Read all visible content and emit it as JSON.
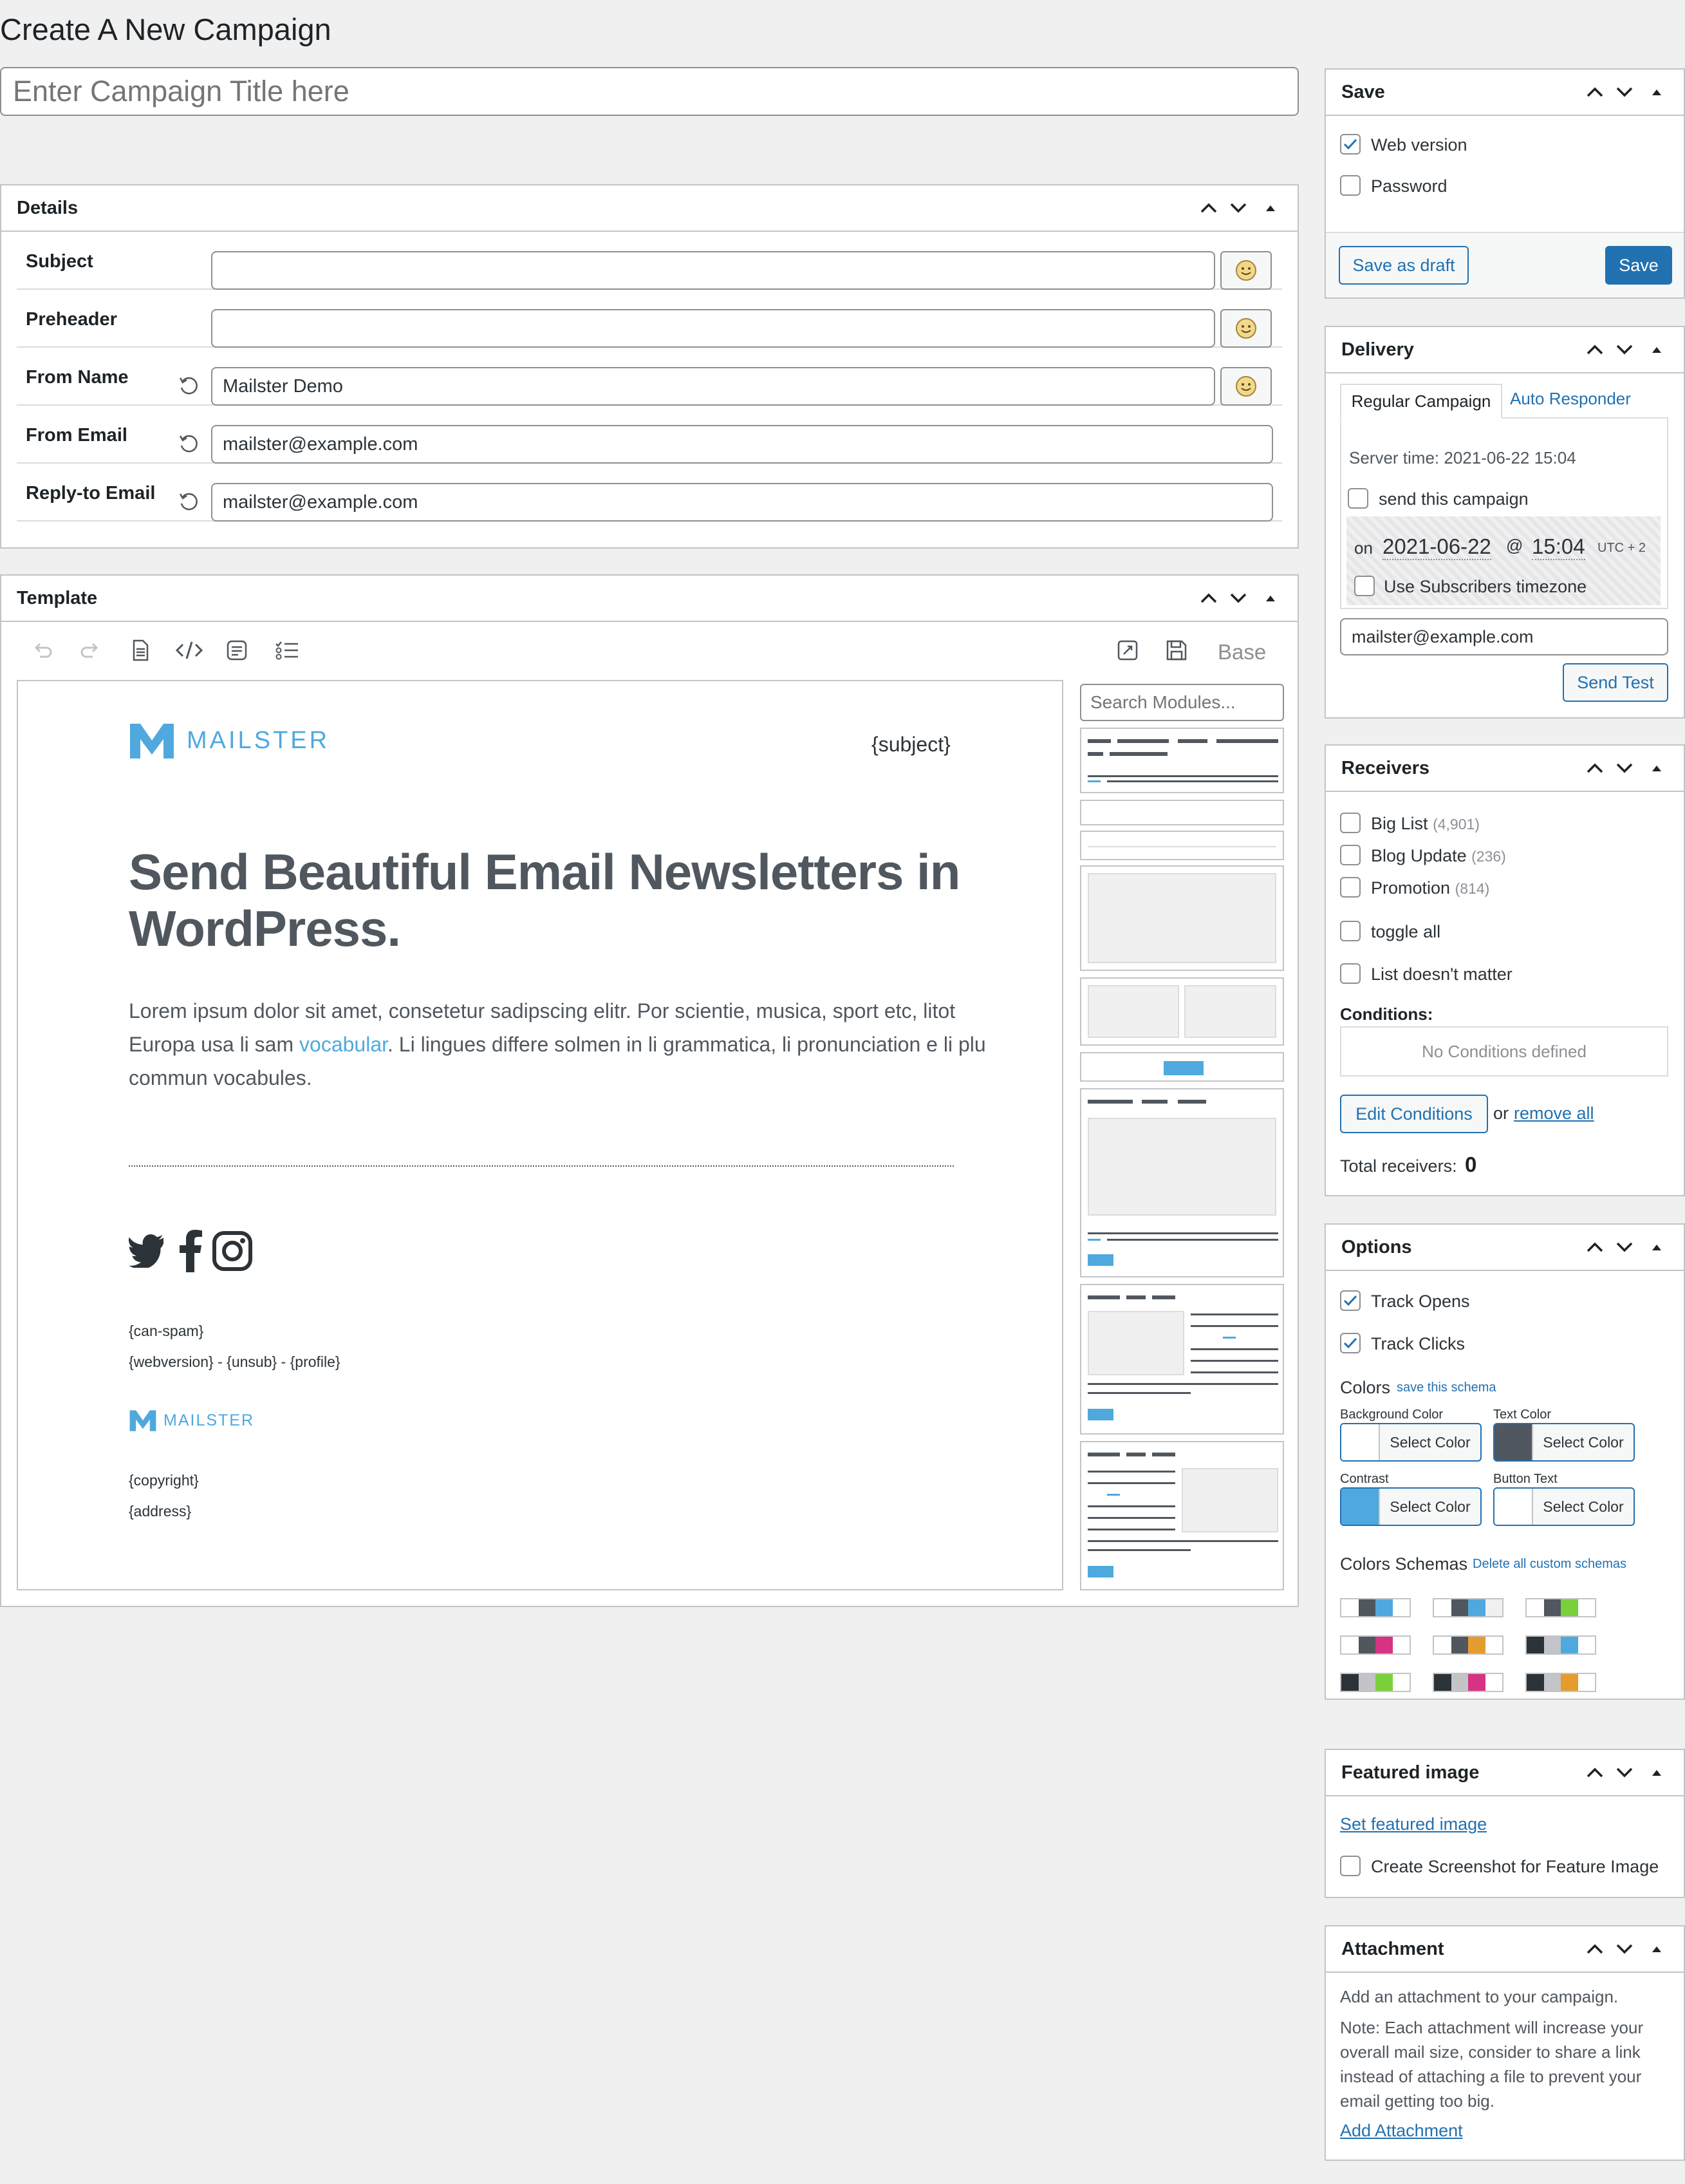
{
  "page": {
    "title": "Create A New Campaign",
    "title_placeholder": "Enter Campaign Title here"
  },
  "details": {
    "title": "Details",
    "subject": {
      "label": "Subject",
      "value": ""
    },
    "preheader": {
      "label": "Preheader",
      "value": ""
    },
    "from_name": {
      "label": "From Name",
      "value": "Mailster Demo"
    },
    "from_email": {
      "label": "From Email",
      "value": "mailster@example.com"
    },
    "reply_to": {
      "label": "Reply-to Email",
      "value": "mailster@example.com"
    }
  },
  "template": {
    "title": "Template",
    "base_label": "Base",
    "search_placeholder": "Search Modules...",
    "preview": {
      "logo_text": "MAILSTER",
      "subject_tag": "{subject}",
      "headline": "Send Beautiful Email Newsletters in WordPress.",
      "body_before_link": "Lorem ipsum dolor sit amet, consetetur sadipscing elitr. Por scientie, musica, sport etc, litot Europa usa li sam ",
      "body_link": "vocabular",
      "body_after_link": ". Li lingues differe solmen in li grammatica, li pronunciation e li plu commun vocabules.",
      "can_spam": "{can-spam}",
      "footer_links": "{webversion} - {unsub} - {profile}",
      "footer_logo": "MAILSTER",
      "copyright": "{copyright}",
      "address": "{address}"
    }
  },
  "save": {
    "title": "Save",
    "web_version": {
      "label": "Web version",
      "checked": true
    },
    "password": {
      "label": "Password",
      "checked": false
    },
    "draft_button": "Save as draft",
    "save_button": "Save"
  },
  "delivery": {
    "title": "Delivery",
    "tabs": [
      "Regular Campaign",
      "Auto Responder"
    ],
    "server_time": "Server time: 2021-06-22 15:04",
    "send_label": "send this campaign",
    "on_label": "on",
    "date": "2021-06-22",
    "at": "@",
    "time": "15:04",
    "utc": "UTC + 2",
    "timezone_label": "Use Subscribers timezone",
    "test_email": "mailster@example.com",
    "send_test_button": "Send Test"
  },
  "receivers": {
    "title": "Receivers",
    "lists": [
      {
        "name": "Big List",
        "count": "(4,901)"
      },
      {
        "name": "Blog Update",
        "count": "(236)"
      },
      {
        "name": "Promotion",
        "count": "(814)"
      }
    ],
    "toggle_all": "toggle all",
    "list_doesnt_matter": "List doesn't matter",
    "conditions_label": "Conditions:",
    "no_conditions": "No Conditions defined",
    "edit_conditions": "Edit Conditions",
    "or": "or",
    "remove_all": "remove all",
    "total_label": "Total receivers:",
    "total": "0"
  },
  "options": {
    "title": "Options",
    "track_opens": "Track Opens",
    "track_clicks": "Track Clicks",
    "colors_label": "Colors",
    "save_schema": "save this schema",
    "bg_color": "Background Color",
    "text_color": "Text Color",
    "contrast": "Contrast",
    "button_text": "Button Text",
    "select_color": "Select Color",
    "schemas_label": "Colors Schemas",
    "delete_schemas": "Delete all custom schemas",
    "colors": {
      "background": "#ffffff",
      "text": "#50575e",
      "contrast": "#4fa9de",
      "button_text": "#ffffff"
    }
  },
  "featured": {
    "title": "Featured image",
    "set_link": "Set featured image",
    "screenshot_label": "Create Screenshot for Feature Image"
  },
  "attachment": {
    "title": "Attachment",
    "intro": "Add an attachment to your campaign.",
    "note": "Note: Each attachment will increase your overall mail size, consider to share a link instead of attaching a file to prevent your email getting too big.",
    "add_link": "Add Attachment"
  }
}
